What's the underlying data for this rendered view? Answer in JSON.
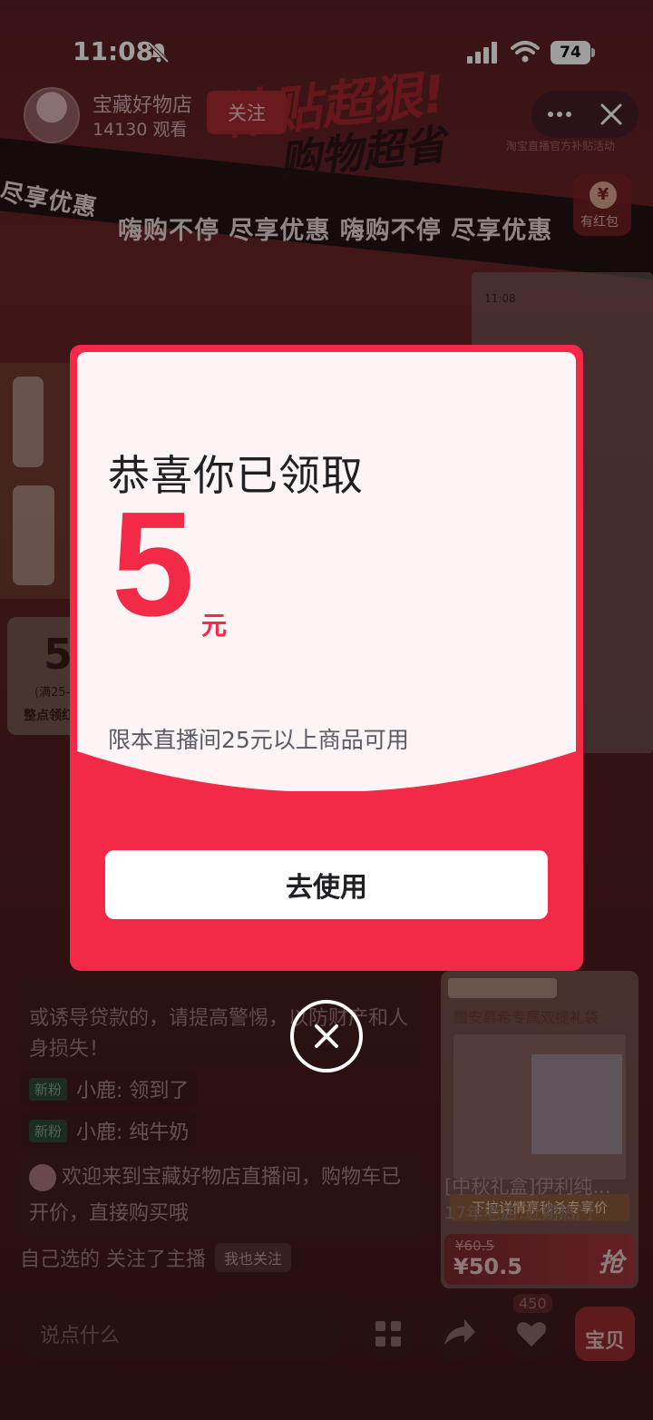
{
  "status_bar": {
    "time": "11:08",
    "battery": "74"
  },
  "stream": {
    "shop_name": "宝藏好物店",
    "viewers": "14130 观看",
    "follow_label": "关注",
    "promo_line1": "补贴超狠!",
    "promo_line2": "购物超省",
    "promo_sub": "淘宝直播官方补贴活动",
    "banner_left": "尽享优惠",
    "banner_text": "嗨购不停 尽享优惠 嗨购不停 尽享优惠",
    "redpacket_label": "有红包",
    "left_coupon_amount": "5",
    "left_coupon_condition": "(满25-",
    "left_coupon_label": "整点领红"
  },
  "chat": {
    "warning": "或诱导贷款的，请提高警惕，以防财产和人身损失！",
    "messages": [
      {
        "tag": "新粉",
        "text": "小鹿: 领到了"
      },
      {
        "tag": "新粉",
        "text": "小鹿: 纯牛奶"
      }
    ],
    "welcome": "欢迎来到宝藏好物店直播间，购物车已开价，直接购买哦",
    "followed_text": "自己选的  关注了主播",
    "me_too_label": "我也关注"
  },
  "product": {
    "image_title": "赠安慕希专属双提礼袋",
    "ribbon": "下拉详情享秒杀专享价",
    "name": "[中秋礼盒]伊利纯...",
    "tag": "17年老店:近期热门",
    "old_price": "¥60.5",
    "price": "¥50.5",
    "grab_label": "抢"
  },
  "bottom_bar": {
    "input_placeholder": "说点什么",
    "like_count": "450",
    "baby_label": "宝贝"
  },
  "modal": {
    "title": "恭喜你已领取",
    "amount": "5",
    "unit": "元",
    "condition": "限本直播间25元以上商品可用",
    "use_button": "去使用"
  },
  "colors": {
    "accent": "#f22a48",
    "modal_bg": "#fcf4f5"
  }
}
